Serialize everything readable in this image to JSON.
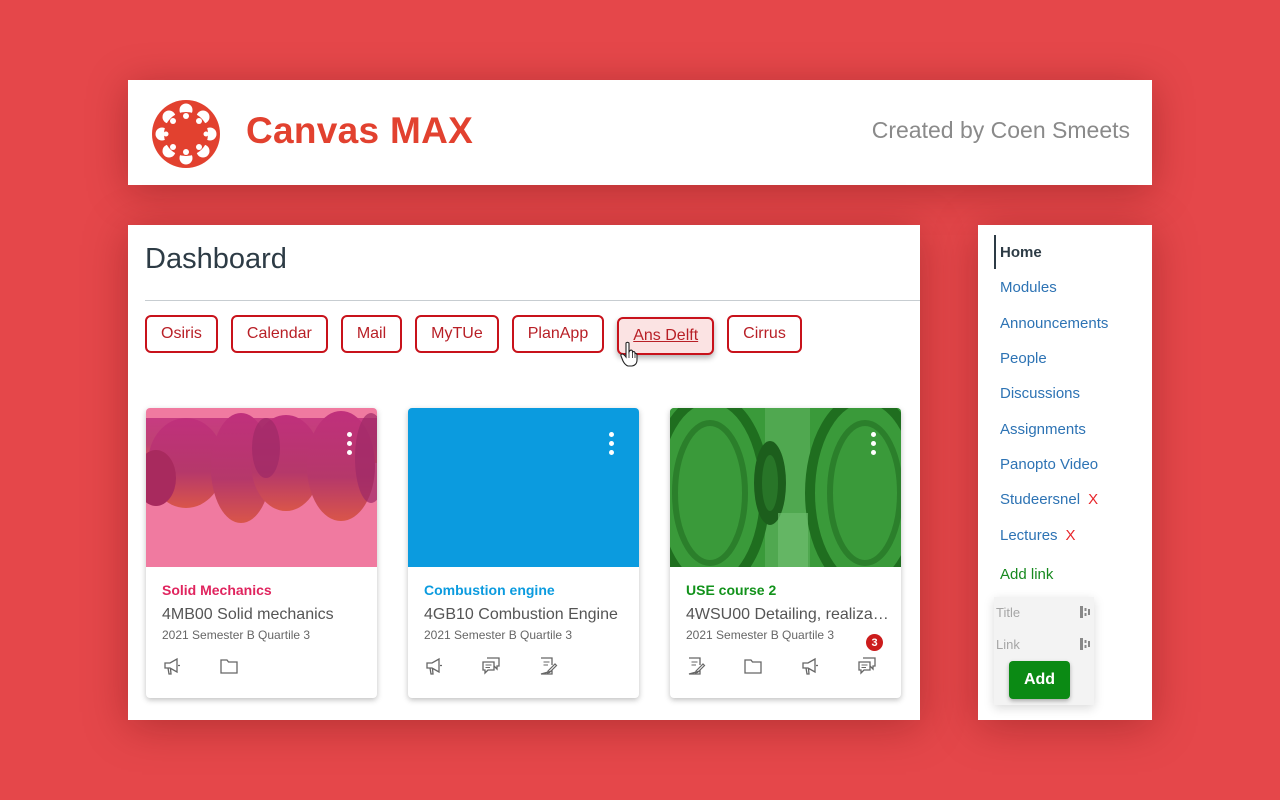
{
  "header": {
    "logo_text": "MAX",
    "app_title": "Canvas MAX",
    "credit": "Created by Coen Smeets",
    "accent_color": "#e2412f"
  },
  "dashboard": {
    "title": "Dashboard",
    "quick_links": [
      {
        "label": "Osiris",
        "state": "normal"
      },
      {
        "label": "Calendar",
        "state": "normal"
      },
      {
        "label": "Mail",
        "state": "normal"
      },
      {
        "label": "MyTUe",
        "state": "normal"
      },
      {
        "label": "PlanApp",
        "state": "normal"
      },
      {
        "label": "Ans Delft",
        "state": "hover"
      },
      {
        "label": "Cirrus",
        "state": "normal"
      }
    ],
    "cards": [
      {
        "nickname": "Solid Mechanics",
        "nickname_color": "#e0245e",
        "name": "4MB00 Solid mechanics",
        "term": "2021 Semester B Quartile 3",
        "image": "crankshaft-pink",
        "icons": [
          "announcements-icon",
          "files-icon"
        ]
      },
      {
        "nickname": "Combustion engine",
        "nickname_color": "#0b9bdf",
        "name": "4GB10 Combustion Engine",
        "term": "2021 Semester B Quartile 3",
        "image": "solid-blue",
        "icons": [
          "announcements-icon",
          "discussions-icon",
          "assignments-icon"
        ]
      },
      {
        "nickname": "USE course 2",
        "nickname_color": "#12921b",
        "name": "4WSU00 Detailing, realization...",
        "term": "2021 Semester B Quartile 3",
        "image": "detector-green",
        "icons": [
          "assignments-icon",
          "files-icon",
          "announcements-icon",
          "discussions-icon"
        ],
        "badge": "3"
      }
    ]
  },
  "course_nav": {
    "items": [
      {
        "label": "Home",
        "active": true,
        "removable": false
      },
      {
        "label": "Modules",
        "active": false,
        "removable": false
      },
      {
        "label": "Announcements",
        "active": false,
        "removable": false
      },
      {
        "label": "People",
        "active": false,
        "removable": false
      },
      {
        "label": "Discussions",
        "active": false,
        "removable": false
      },
      {
        "label": "Assignments",
        "active": false,
        "removable": false
      },
      {
        "label": "Panopto Video",
        "active": false,
        "removable": false
      },
      {
        "label": "Studeersnel",
        "active": false,
        "removable": true
      },
      {
        "label": "Lectures",
        "active": false,
        "removable": true
      }
    ],
    "remove_symbol": "X",
    "add_link_label": "Add link",
    "form": {
      "title_placeholder": "Title",
      "link_placeholder": "Link",
      "add_button": "Add"
    }
  }
}
